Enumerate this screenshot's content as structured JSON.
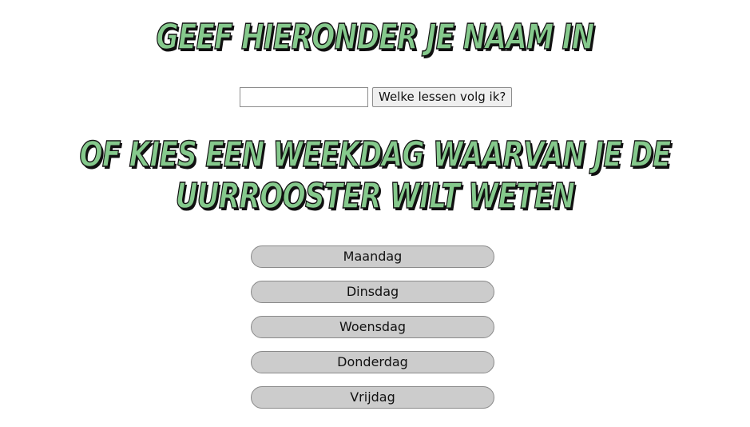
{
  "header": {
    "title": "Geef hieronder je naam in"
  },
  "search": {
    "input_value": "",
    "input_placeholder": "",
    "button_label": "Welke lessen volg ik?"
  },
  "weekday_section": {
    "title": "Of kies een weekdag waarvan je de uurrooster wilt weten",
    "days": [
      {
        "label": "Maandag"
      },
      {
        "label": "Dinsdag"
      },
      {
        "label": "Woensdag"
      },
      {
        "label": "Donderdag"
      },
      {
        "label": "Vrijdag"
      }
    ]
  },
  "colors": {
    "heading_fill": "#85c98c",
    "heading_outline": "#111111",
    "day_button_bg": "#cccccc"
  }
}
